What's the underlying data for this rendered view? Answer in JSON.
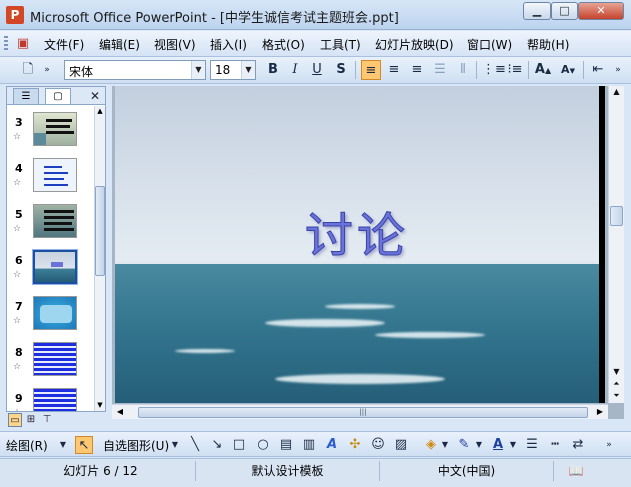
{
  "window": {
    "title": "Microsoft Office PowerPoint - [中学生诚信考试主题班会.ppt]",
    "app_icon": "powerpoint-icon"
  },
  "menu": {
    "items": [
      "文件(F)",
      "编辑(E)",
      "视图(V)",
      "插入(I)",
      "格式(O)",
      "工具(T)",
      "幻灯片放映(D)",
      "窗口(W)",
      "帮助(H)"
    ]
  },
  "format_toolbar": {
    "font_name": "宋体",
    "font_size": "18",
    "bold": "B",
    "italic": "I",
    "underline": "U",
    "shadow": "S",
    "active_alignment": "align-left"
  },
  "slide_pane": {
    "tabs": [
      "outline-tab",
      "slides-tab"
    ],
    "selected_slide": 6,
    "thumbnails": [
      {
        "num": "3"
      },
      {
        "num": "4"
      },
      {
        "num": "5"
      },
      {
        "num": "6"
      },
      {
        "num": "7"
      },
      {
        "num": "8"
      },
      {
        "num": "9"
      }
    ]
  },
  "slide": {
    "title": "讨论"
  },
  "draw_toolbar": {
    "draw_label": "绘图(R)",
    "autoshapes_label": "自选图形(U)"
  },
  "status": {
    "slide_position": "幻灯片 6 / 12",
    "design": "默认设计模板",
    "language": "中文(中国)"
  }
}
